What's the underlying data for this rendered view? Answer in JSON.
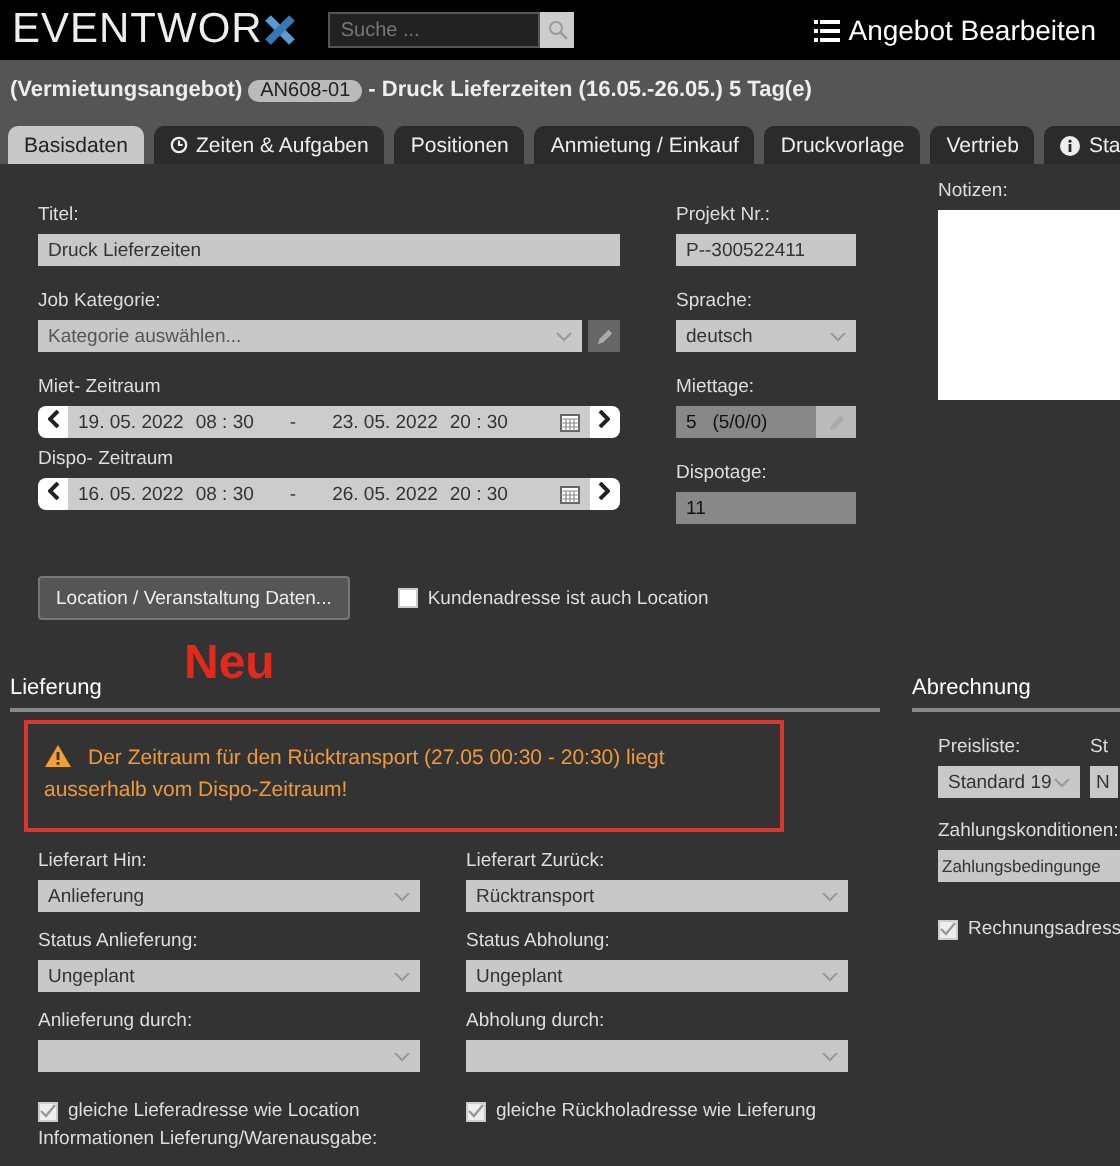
{
  "header": {
    "logo": "EVENTWOR",
    "search": {
      "placeholder": "Suche ..."
    },
    "menu_title": "Angebot Bearbeiten"
  },
  "title_bar": {
    "type": "(Vermietungsangebot)",
    "badge": "AN608-01",
    "title": "- Druck Lieferzeiten (16.05.-26.05.) 5 Tag(e)"
  },
  "tabs": [
    {
      "label": "Basisdaten",
      "selected": true,
      "kind": "plain"
    },
    {
      "label": "Zeiten & Aufgaben",
      "selected": false,
      "kind": "clock"
    },
    {
      "label": "Positionen",
      "selected": false,
      "kind": "plain"
    },
    {
      "label": "Anmietung / Einkauf",
      "selected": false,
      "kind": "plain"
    },
    {
      "label": "Druckvorlage",
      "selected": false,
      "kind": "plain"
    },
    {
      "label": "Vertrieb",
      "selected": false,
      "kind": "plain"
    },
    {
      "label": "Sta",
      "selected": false,
      "kind": "info"
    }
  ],
  "basis": {
    "left": [
      {
        "label": "Titel:",
        "kind": "text",
        "value": "Druck Lieferzeiten"
      },
      {
        "label": "Job Kategorie:",
        "kind": "select_edit",
        "placeholder": "Kategorie auswählen..."
      },
      {
        "label": "Miet- Zeitraum",
        "kind": "daterange",
        "start_date": "19. 05. 2022",
        "start_time": "08 : 30",
        "separator": "-",
        "end_date": "23. 05. 2022",
        "end_time": "20 : 30"
      },
      {
        "label": "Dispo- Zeitraum",
        "kind": "daterange",
        "start_date": "16. 05. 2022",
        "start_time": "08 : 30",
        "separator": "-",
        "end_date": "26. 05. 2022",
        "end_time": "20 : 30"
      }
    ],
    "middle": [
      {
        "label": "Projekt Nr.:",
        "kind": "text",
        "value": "P--300522411"
      },
      {
        "label": "Sprache:",
        "kind": "select",
        "value": "deutsch"
      },
      {
        "label": "Miettage:",
        "kind": "readonly_edit",
        "value": "5   (5/0/0)"
      },
      {
        "label": "Dispotage:",
        "kind": "readonly",
        "value": "11"
      }
    ],
    "notes": {
      "label": "Notizen:"
    }
  },
  "location_button": "Location / Veranstaltung Daten...",
  "customer_is_location": {
    "label": "Kundenadresse ist auch Location",
    "checked": false
  },
  "annotation": "Neu",
  "lieferung": {
    "title": "Lieferung",
    "warning": "Der Zeitraum für den Rücktransport (27.05 00:30 - 20:30) liegt ausserhalb vom Dispo-Zeitraum!",
    "fields": [
      {
        "label": "Lieferart Hin:",
        "value": "Anlieferung"
      },
      {
        "label": "Lieferart Zurück:",
        "value": "Rücktransport"
      },
      {
        "label": "Status Anlieferung:",
        "value": "Ungeplant"
      },
      {
        "label": "Status Abholung:",
        "value": "Ungeplant"
      },
      {
        "label": "Anlieferung durch:"
      },
      {
        "label": "Abholung durch:"
      }
    ],
    "checks": [
      {
        "label": "gleiche Lieferadresse wie Location",
        "checked": true
      },
      {
        "label": "gleiche Rückholadresse wie Lieferung",
        "checked": true
      }
    ],
    "info_label": "Informationen Lieferung/Warenausgabe:"
  },
  "abrechnung": {
    "title": "Abrechnung",
    "fields": [
      {
        "label": "Preisliste:",
        "value": "Standard 19"
      },
      {
        "label": "St",
        "value": "N"
      }
    ],
    "payment": {
      "label": "Zahlungskonditionen:",
      "value": "Zahlungsbedingunge"
    },
    "invoice_check": {
      "label": "Rechnungsadress",
      "checked": true
    }
  }
}
